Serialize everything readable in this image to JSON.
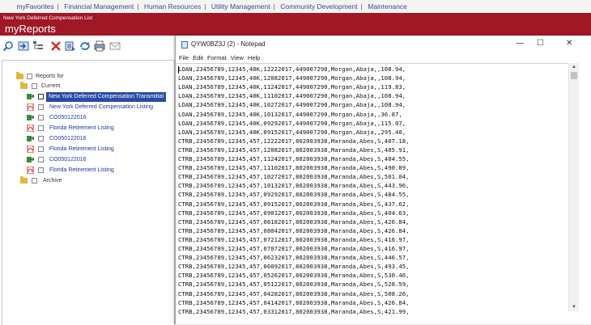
{
  "topnav": [
    "myFavorites",
    "Financial Management",
    "Human Resources",
    "Utility Management",
    "Community Development",
    "Maintenance"
  ],
  "header": {
    "subtitle": "New York Deferred Compensation List",
    "title": "myReports"
  },
  "tree": {
    "root": "Reports for",
    "current": "Current",
    "archive": "Archive",
    "items": [
      {
        "label": "New York Deferred Compensation Transmittal",
        "selected": true
      },
      {
        "label": "New York Deferred Compensation Listing"
      },
      {
        "label": "CO050122016"
      },
      {
        "label": "Florida Retirement Listing"
      },
      {
        "label": "CO050122016"
      },
      {
        "label": "Florida Retirement Listing"
      },
      {
        "label": "CO050122016"
      },
      {
        "label": "Florida Retirement Listing"
      }
    ]
  },
  "notepad": {
    "title": "QYW0BZ3J (2) - Notepad",
    "controls": {
      "minimize": "—",
      "maximize": "☐",
      "close": "✕"
    },
    "menu": [
      "File",
      "Edit",
      "Format",
      "View",
      "Help"
    ],
    "lines": [
      "LOAN,23456789,12345,40K,12222017,449007290,Morgan,Abaja,,108.94,",
      "LOAN,23456789,12345,40K,12082017,449007290,Morgan,Abaja,,108.94,",
      "LOAN,23456789,12345,40K,11242017,449007290,Morgan,Abaja,,119.83,",
      "LOAN,23456789,12345,40K,11102017,449007290,Morgan,Abaja,,108.94,",
      "LOAN,23456789,12345,40K,10272017,449007290,Morgan,Abaja,,108.94,",
      "LOAN,23456789,12345,40K,10132017,449007290,Morgan,Abaja,,36.87,",
      "LOAN,23456789,12345,40K,09292017,449007290,Morgan,Abaja,,115.07,",
      "LOAN,23456789,12345,40K,09152017,449007290,Morgan,Abaja,,295.40,",
      "CTRB,23456789,12345,457,12222017,802003938,Maranda,Abes,S,407.18,",
      "CTRB,23456789,12345,457,12082017,802003938,Maranda,Abes,S,405.91,",
      "CTRB,23456789,12345,457,11242017,802003938,Maranda,Abes,S,484.55,",
      "CTRB,23456789,12345,457,11102017,802003938,Maranda,Abes,S,490.89,",
      "CTRB,23456789,12345,457,10272017,802003938,Maranda,Abes,S,501.04,",
      "CTRB,23456789,12345,457,10132017,802003938,Maranda,Abes,S,443.96,",
      "CTRB,23456789,12345,457,09292017,802003938,Maranda,Abes,S,484.55,",
      "CTRB,23456789,12345,457,09152017,802003938,Maranda,Abes,S,437.62,",
      "CTRB,23456789,12345,457,09012017,802003938,Maranda,Abes,S,404.63,",
      "CTRB,23456789,12345,457,08182017,802003938,Maranda,Abes,S,426.84,",
      "CTRB,23456789,12345,457,08042017,802003938,Maranda,Abes,S,426.84,",
      "CTRB,23456789,12345,457,07212017,802003938,Maranda,Abes,S,416.97,",
      "CTRB,23456789,12345,457,07072017,802003938,Maranda,Abes,S,416.97,",
      "CTRB,23456789,12345,457,06232017,802003938,Maranda,Abes,S,446.57,",
      "CTRB,23456789,12345,457,06092017,802003938,Maranda,Abes,S,493.45,",
      "CTRB,23456789,12345,457,05262017,802003938,Maranda,Abes,S,530.46,",
      "CTRB,23456789,12345,457,05122017,802003938,Maranda,Abes,S,528.59,",
      "CTRB,23456789,12345,457,04282017,802003938,Maranda,Abes,S,508.26,",
      "CTRB,23456789,12345,457,04142017,802003938,Maranda,Abes,S,426.84,",
      "CTRB,23456789,12345,457,03312017,802003938,Maranda,Abes,S,421.99,"
    ]
  },
  "colors": {
    "header_red": "#a01726",
    "link_blue": "#1a35a5",
    "selection": "#2b4aa6"
  }
}
